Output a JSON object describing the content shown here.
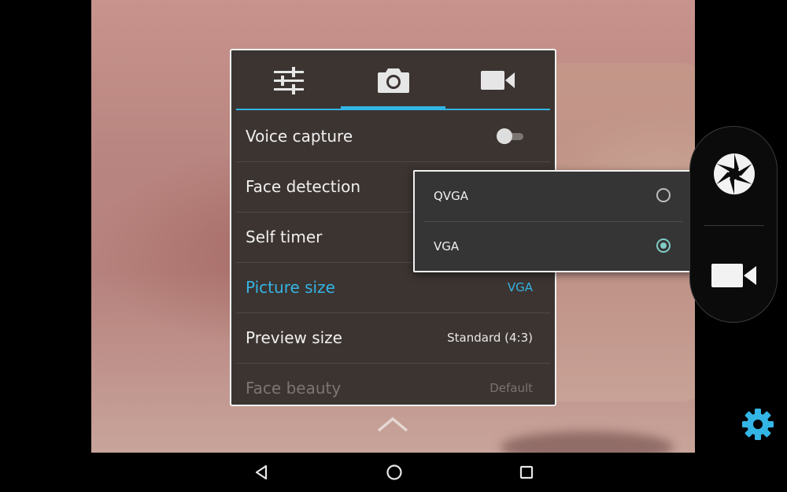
{
  "settings_panel": {
    "tabs": [
      {
        "id": "general",
        "icon": "sliders-icon"
      },
      {
        "id": "photo",
        "icon": "camera-icon",
        "active": true
      },
      {
        "id": "video",
        "icon": "videocam-icon"
      }
    ],
    "rows": [
      {
        "label": "Voice capture",
        "control": "toggle",
        "toggle_on": false
      },
      {
        "label": "Face detection"
      },
      {
        "label": "Self timer"
      },
      {
        "label": "Picture size",
        "value": "VGA",
        "active": true
      },
      {
        "label": "Preview size",
        "value": "Standard (4:3)"
      },
      {
        "label": "Face beauty",
        "value": "Default",
        "disabled": true
      }
    ]
  },
  "picture_size_popup": {
    "options": [
      {
        "label": "QVGA",
        "selected": false
      },
      {
        "label": "VGA",
        "selected": true
      }
    ]
  },
  "collapse_control": {
    "icon": "chevron-up-icon"
  },
  "mode_switcher": {
    "photo_icon": "shutter-icon",
    "video_icon": "videocam-icon"
  },
  "settings_button": {
    "icon": "gear-icon"
  },
  "nav_bar": {
    "back_icon": "back-icon",
    "home_icon": "home-icon",
    "recents_icon": "recents-icon"
  },
  "colors": {
    "accent": "#33b5e5",
    "radio_selected": "#80cbc4",
    "gear": "#33b5e5"
  }
}
